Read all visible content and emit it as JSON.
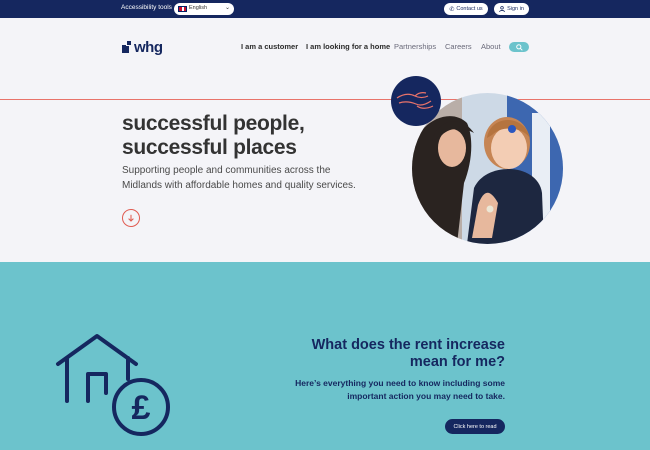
{
  "topbar": {
    "accessibility_label": "Accessibility tools",
    "language": {
      "selected": "English",
      "flag_icon": "uk-flag-icon"
    },
    "contact_label": "Contact us",
    "signin_label": "Sign in"
  },
  "header": {
    "logo_text": "whg",
    "nav": [
      {
        "label": "I am a customer"
      },
      {
        "label": "I am looking for a home"
      },
      {
        "label": "Partnerships"
      },
      {
        "label": "Careers"
      },
      {
        "label": "About"
      }
    ],
    "search_icon": "search-icon"
  },
  "hero": {
    "title": "successful people,\nsuccessful places",
    "subtitle": "Supporting people and communities across the Midlands with affordable homes and quality services."
  },
  "rent": {
    "title": "What does the rent increase\nmean for me?",
    "subtitle": "Here’s everything you need to know including some important action you may need to take.",
    "cta_label": "Click here to read"
  },
  "colors": {
    "navy": "#15275f",
    "teal": "#6cc3cc",
    "coral": "#e8736a",
    "hero_bg": "#f4f4f8"
  }
}
